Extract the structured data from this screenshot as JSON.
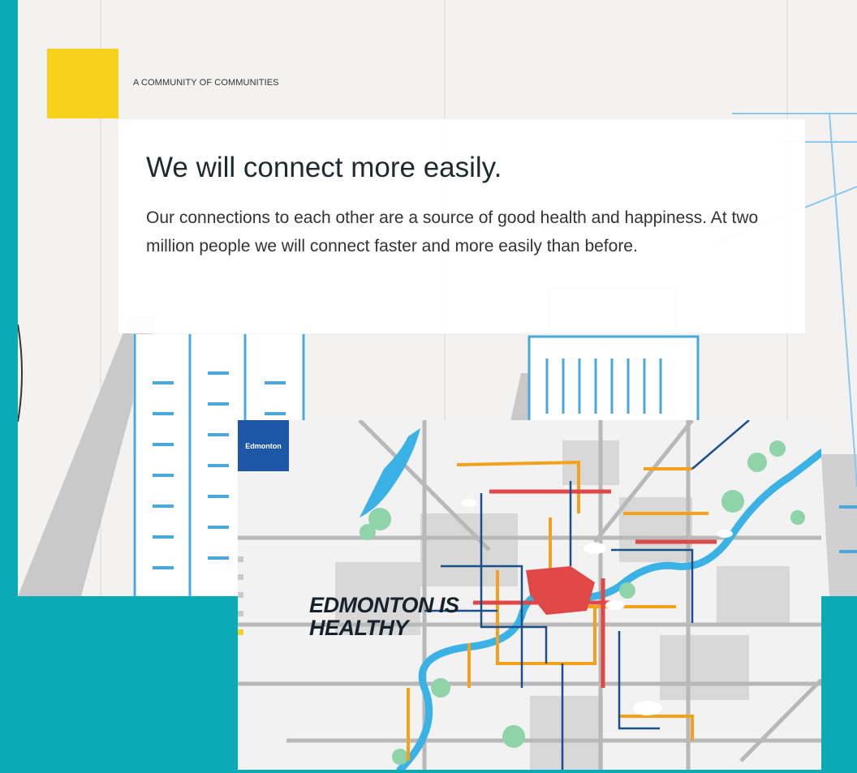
{
  "page": {
    "eyebrow": "A COMMUNITY OF COMMUNITIES",
    "headline": "We will connect more easily.",
    "body": "Our connections to each other are a source of good health and happiness. At two million people we will connect faster and more easily than before."
  },
  "map_card": {
    "logo_text": "Edmonton",
    "title_line1": "EDMONTON IS",
    "title_line2": "HEALTHY"
  },
  "colors": {
    "background": "#0aaab6",
    "accent_yellow": "#f8d21a",
    "line_blue": "#4aa8dc",
    "transit_red": "#e04848",
    "transit_orange": "#f4a21c",
    "transit_navy": "#1b4f8a",
    "river": "#3ab2e6",
    "logo_blue": "#1e56a8"
  }
}
